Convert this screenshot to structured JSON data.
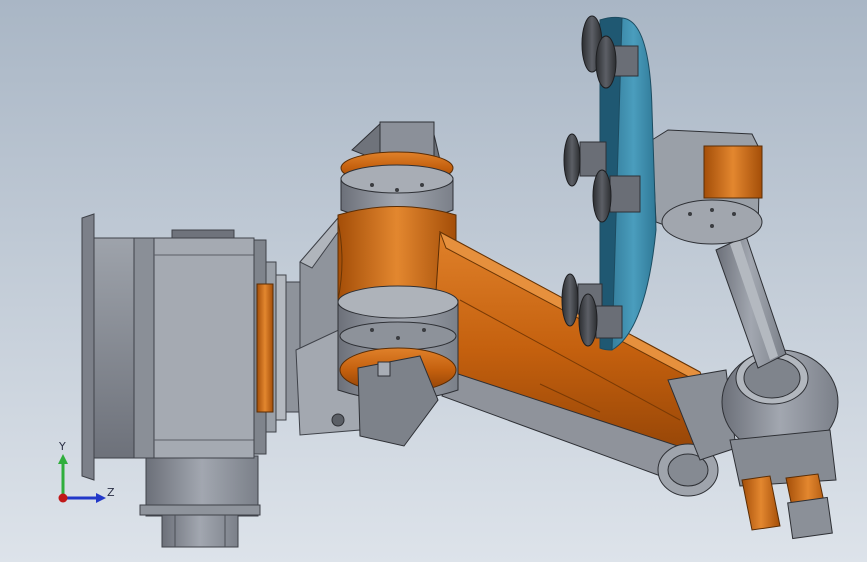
{
  "viewport": {
    "background_top": "#a9b6c5",
    "background_bottom": "#dde3ea"
  },
  "model": {
    "base_color": "#8e939d",
    "arm_color": "#c8660f",
    "disc_color": "#3d8fae",
    "cup_color": "#3a3c40"
  },
  "triad": {
    "y_label": "Y",
    "z_label": "Z",
    "y_color": "#2fae3c",
    "z_color": "#2238c9",
    "x_color": "#c01818"
  }
}
